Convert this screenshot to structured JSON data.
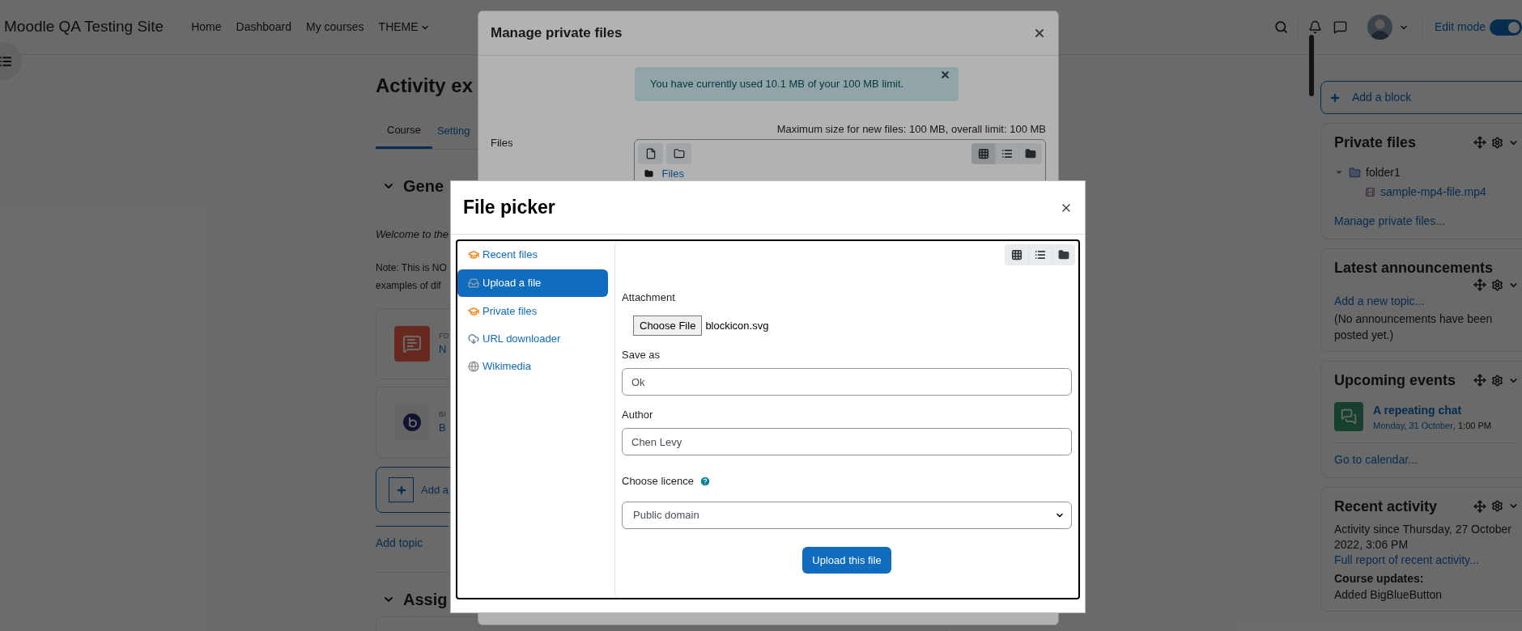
{
  "navbar": {
    "site_name": "Moodle QA Testing Site",
    "links": [
      {
        "kind": "link",
        "label": "Home"
      },
      {
        "kind": "link",
        "label": "Dashboard"
      },
      {
        "kind": "link",
        "label": "My courses"
      },
      {
        "kind": "menu",
        "label": "THEME"
      }
    ],
    "edit_mode": {
      "label": "Edit mode",
      "on": true
    }
  },
  "page": {
    "title": "Activity ex",
    "tabs": [
      {
        "label": "Course",
        "selected": true
      },
      {
        "label": "Setting",
        "selected": false
      }
    ],
    "section_title": "Gene",
    "intro": "Welcome to the",
    "note_lines": [
      "Note: This is NO",
      "examples of dif"
    ],
    "activities": [
      {
        "kind": "forum",
        "type_label": "FO",
        "name": "N"
      },
      {
        "kind": "bigbluebutton",
        "type_label": "BI",
        "name": "B"
      }
    ],
    "add_activity": "Add a",
    "add_topic": "Add topic",
    "next_section_title": "Assig"
  },
  "sidebar": {
    "add_block": "Add a block",
    "blocks": [
      {
        "kind": "private_files",
        "title": "Private files",
        "tree": [
          {
            "name": "folder1",
            "expanded": true,
            "children": [
              {
                "name": "sample-mp4-file.mp4"
              }
            ]
          }
        ],
        "link": "Manage private files..."
      },
      {
        "kind": "announcements",
        "title": "Latest announcements",
        "link": "Add a new topic...",
        "text": "(No announcements have been posted yet.)"
      },
      {
        "kind": "events",
        "title": "Upcoming events",
        "events": [
          {
            "name": "A repeating chat",
            "date": "Monday, 31 October",
            "time": ", 1:00 PM"
          }
        ],
        "link": "Go to calendar..."
      },
      {
        "kind": "recent",
        "title": "Recent activity",
        "text": "Activity since Thursday, 27 October 2022, 3:06 PM",
        "link": "Full report of recent activity...",
        "subheading": "Course updates:",
        "item": "Added BigBlueButton"
      }
    ]
  },
  "manage_modal": {
    "title": "Manage private files",
    "alert": "You have currently used 10.1 MB of your 100 MB limit.",
    "files_label": "Files",
    "limits": "Maximum size for new files: 100 MB, overall limit: 100 MB",
    "views": [
      {
        "kind": "icons",
        "selected": true
      },
      {
        "kind": "list",
        "selected": false
      },
      {
        "kind": "tree",
        "selected": false
      }
    ],
    "folder": "Files"
  },
  "file_picker": {
    "title": "File picker",
    "repositories": [
      {
        "kind": "recent",
        "label": "Recent files",
        "selected": false
      },
      {
        "kind": "upload",
        "label": "Upload a file",
        "selected": true
      },
      {
        "kind": "private",
        "label": "Private files",
        "selected": false
      },
      {
        "kind": "url",
        "label": "URL downloader",
        "selected": false
      },
      {
        "kind": "wikimedia",
        "label": "Wikimedia",
        "selected": false
      }
    ],
    "views": [
      {
        "kind": "icons",
        "selected": false
      },
      {
        "kind": "list",
        "selected": false
      },
      {
        "kind": "tree",
        "selected": false
      }
    ],
    "form": {
      "attachment_label": "Attachment",
      "choose_button": "Choose File",
      "file_name": "blockicon.svg",
      "save_as_label": "Save as",
      "save_as_value": "Ok",
      "author_label": "Author",
      "author_value": "Chen Levy",
      "licence_label": "Choose licence",
      "licence_value": "Public domain",
      "submit": "Upload this file"
    }
  }
}
